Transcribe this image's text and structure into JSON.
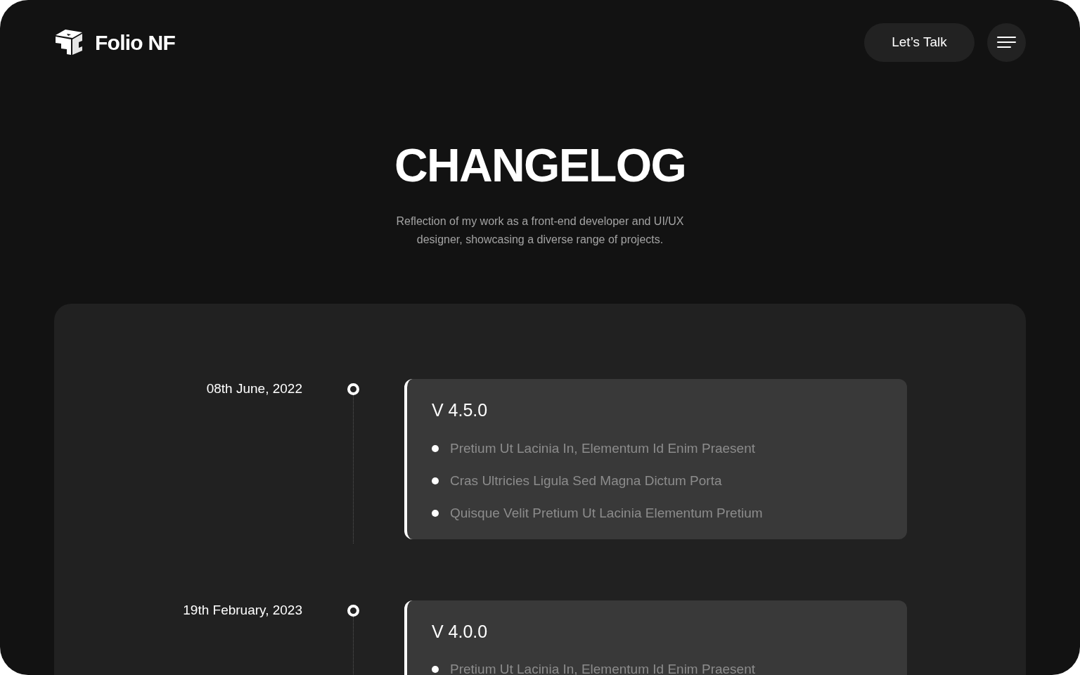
{
  "header": {
    "brand": "Folio NF",
    "cta": "Let’s Talk"
  },
  "hero": {
    "title": "CHANGELOG",
    "subtitle": "Reflection of my work as a front-end developer and UI/UX designer, showcasing a diverse range of projects."
  },
  "entries": [
    {
      "date": "08th June, 2022",
      "version": "V 4.5.0",
      "items": [
        "Pretium Ut Lacinia In, Elementum Id Enim Praesent",
        "Cras Ultricies Ligula Sed Magna Dictum Porta",
        "Quisque Velit Pretium Ut Lacinia Elementum Pretium"
      ]
    },
    {
      "date": "19th February, 2023",
      "version": "V 4.0.0",
      "items": [
        "Pretium Ut Lacinia In, Elementum Id Enim Praesent"
      ]
    }
  ]
}
